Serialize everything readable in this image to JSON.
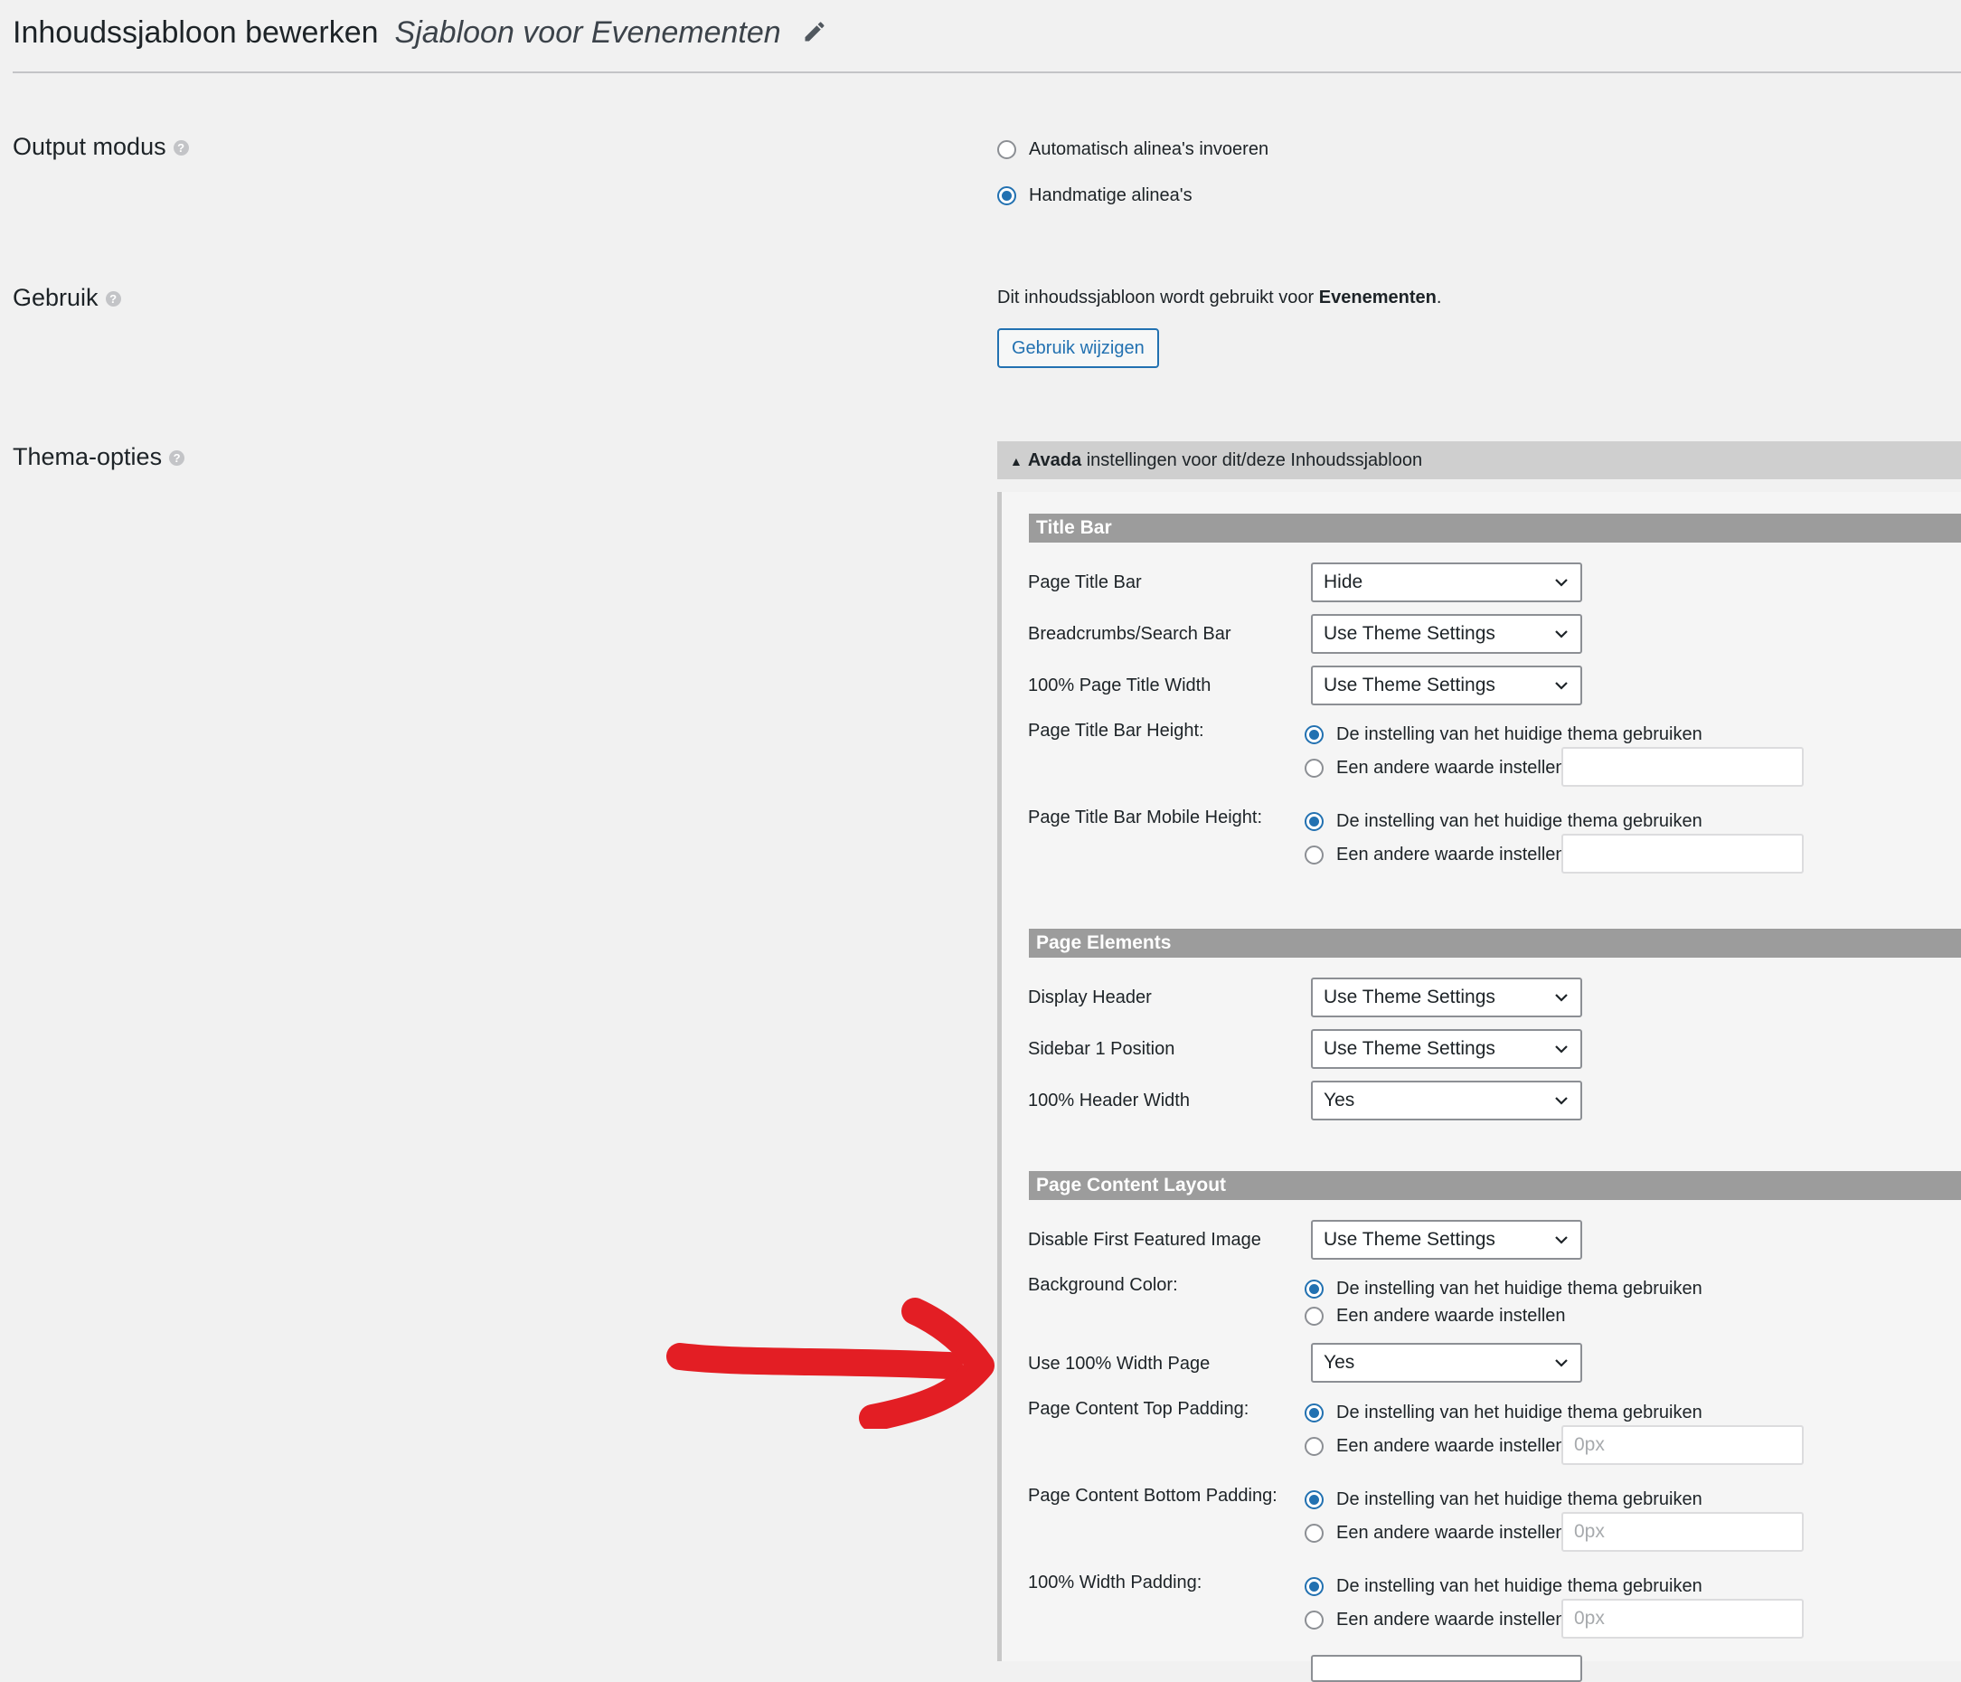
{
  "header": {
    "title": "Inhoudssjabloon bewerken",
    "template_name": "Sjabloon voor Evenementen",
    "edit_icon": "pencil-icon"
  },
  "output_mode": {
    "label": "Output modus",
    "options": [
      {
        "label": "Automatisch alinea's invoeren",
        "selected": false
      },
      {
        "label": "Handmatige alinea's",
        "selected": true
      }
    ]
  },
  "usage": {
    "label": "Gebruik",
    "text_prefix": "Dit inhoudssjabloon wordt gebruikt voor ",
    "text_target": "Evenementen",
    "text_suffix": ".",
    "button": "Gebruik wijzigen"
  },
  "theme_options": {
    "label": "Thema-opties",
    "panel_brand": "Avada",
    "panel_title_rest": " instellingen voor dit/deze Inhoudssjabloon",
    "radio_theme": "De instelling van het huidige thema gebruiken",
    "radio_custom": "Een andere waarde instellen"
  },
  "sections": {
    "title_bar": {
      "title": "Title Bar",
      "page_title_bar": {
        "label": "Page Title Bar",
        "value": "Hide"
      },
      "breadcrumbs": {
        "label": "Breadcrumbs/Search Bar",
        "value": "Use Theme Settings"
      },
      "title_width": {
        "label": "100% Page Title Width",
        "value": "Use Theme Settings"
      },
      "bar_height": {
        "label": "Page Title Bar Height:",
        "input": ""
      },
      "bar_mobile_height": {
        "label": "Page Title Bar Mobile Height:",
        "input": ""
      }
    },
    "page_elements": {
      "title": "Page Elements",
      "display_header": {
        "label": "Display Header",
        "value": "Use Theme Settings"
      },
      "sidebar_position": {
        "label": "Sidebar 1 Position",
        "value": "Use Theme Settings"
      },
      "header_width": {
        "label": "100% Header Width",
        "value": "Yes"
      }
    },
    "content_layout": {
      "title": "Page Content Layout",
      "disable_featured": {
        "label": "Disable First Featured Image",
        "value": "Use Theme Settings"
      },
      "background_color": {
        "label": "Background Color:"
      },
      "full_width": {
        "label": "Use 100% Width Page",
        "value": "Yes"
      },
      "top_padding": {
        "label": "Page Content Top Padding:",
        "placeholder": "0px"
      },
      "bottom_padding": {
        "label": "Page Content Bottom Padding:",
        "placeholder": "0px"
      },
      "width_padding": {
        "label": "100% Width Padding:",
        "placeholder": "0px"
      }
    }
  },
  "colors": {
    "accent": "#2271b1",
    "annotation_arrow": "#e31e24"
  }
}
